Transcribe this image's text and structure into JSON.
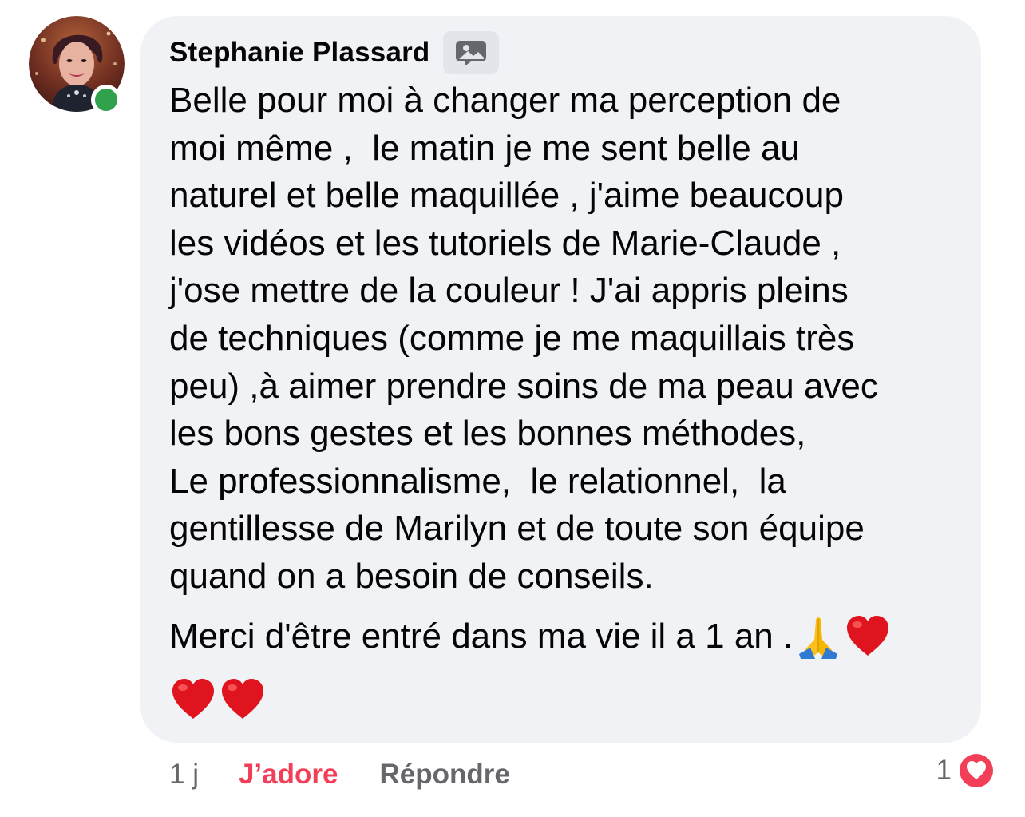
{
  "comment": {
    "author": "Stephanie Plassard",
    "author_online": true,
    "media_badge_icon": "photo-gallery-icon",
    "body_lines": [
      "Belle pour moi à changer ma perception de",
      "moi même ,  le matin je me sent belle au",
      "naturel et belle maquillée , j'aime beaucoup",
      "les vidéos et les tutoriels de Marie-Claude ,",
      "j'ose mettre de la couleur ! J'ai appris pleins",
      "de techniques (comme je me maquillais très",
      "peu) ,à aimer prendre soins de ma peau avec",
      "les bons gestes et les bonnes méthodes,",
      "Le professionnalisme,  le relationnel,  la",
      "gentillesse de Marilyn et de toute son équipe",
      "quand on a besoin de conseils."
    ],
    "closing_text": "Merci d'être entré dans ma vie il a 1 an .",
    "closing_emojis": [
      "🙏",
      "❤️"
    ],
    "extra_emojis": [
      "❤️",
      "❤️"
    ]
  },
  "footer": {
    "time": "1 j",
    "love_label": "J’adore",
    "reply_label": "Répondre",
    "reaction_count": "1",
    "reaction_icon": "heart-icon"
  },
  "colors": {
    "bubble": "#f0f2f5",
    "text": "#050505",
    "secondary": "#65676b",
    "love": "#f33e58",
    "online": "#31a24c"
  }
}
